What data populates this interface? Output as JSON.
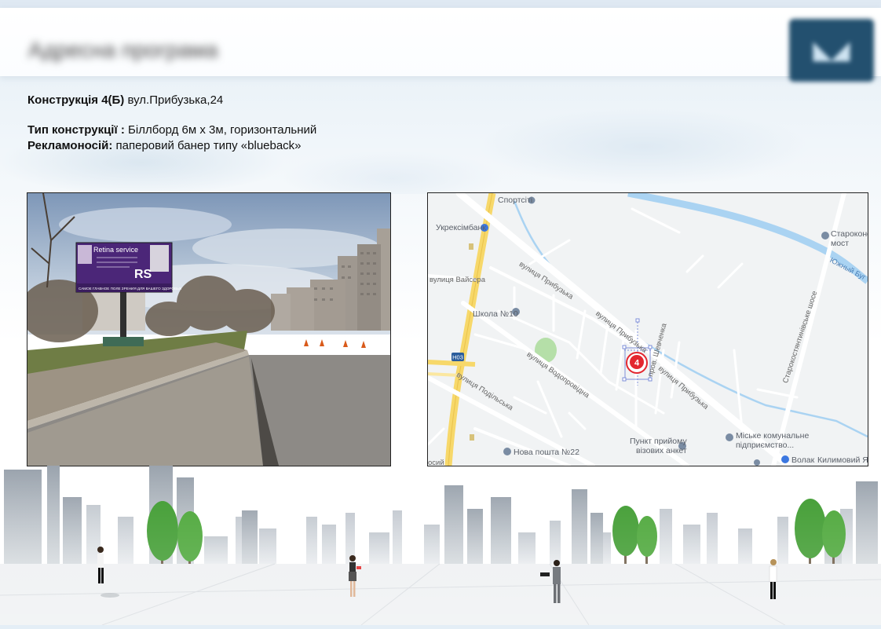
{
  "slide": {
    "title_blurred": "Адресна програма",
    "logo_blurred": "◣◢"
  },
  "construction": {
    "label": "Конструкція 4(Б)",
    "address": " вул.Прибузька,24",
    "type_label": "Тип конструкції :",
    "type_value": " Біллборд  6м х  3м, горизонтальний",
    "carrier_label": "Рекламоносій:",
    "carrier_value": " паперовий  банер типу  «blueback»"
  },
  "photo": {
    "billboard_title": "Retina service",
    "billboard_logo": "RS",
    "billboard_tagline": "САМОЕ ГЛАВНОЕ ПОЛЕ ЗРЕНИЯ ДЛЯ ВАШЕГО ЗДОРОВЬЯ"
  },
  "map": {
    "marker_number": "4",
    "road_badge": "Н03",
    "pois": [
      {
        "id": "sportsiti",
        "label": "Спортсіті"
      },
      {
        "id": "ukreksimbank",
        "label": "Укрексімбанк"
      },
      {
        "id": "school10",
        "label": "Школа №10"
      },
      {
        "id": "nova-poshta",
        "label": "Нова пошта №22"
      },
      {
        "id": "visa-point",
        "label": "Пункт прийому\nвізових анкет"
      },
      {
        "id": "misk-komunalne",
        "label": "Міське комунальне\nпідприємство..."
      },
      {
        "id": "bridge",
        "label": "Староконст\nмост"
      },
      {
        "id": "volak",
        "label": "Волак"
      },
      {
        "id": "kylymovyi",
        "label": "Килимовий Ярм"
      }
    ],
    "streets": {
      "prybuzka_1": "вулиця Прибузька",
      "prybuzka_2": "вулиця Прибузька",
      "prybuzka_3": "вулиця Прибузька",
      "vodoprovidna": "вулиця Водопровідна",
      "podilska": "вулиця Подільська",
      "vaisera": "вулиця Вайсера",
      "shevchenka": "пров. Шевченка",
      "starokostiantynivske": "Старокостянтинівське шосе",
      "yuzhnyi_buh": "Южный Буг",
      "cut_left": "осий"
    },
    "colors": {
      "water": "#aad3f2",
      "road_main": "#f7d86a",
      "road": "#ffffff",
      "park": "#b5dfa8",
      "marker": "#e3262f"
    }
  }
}
